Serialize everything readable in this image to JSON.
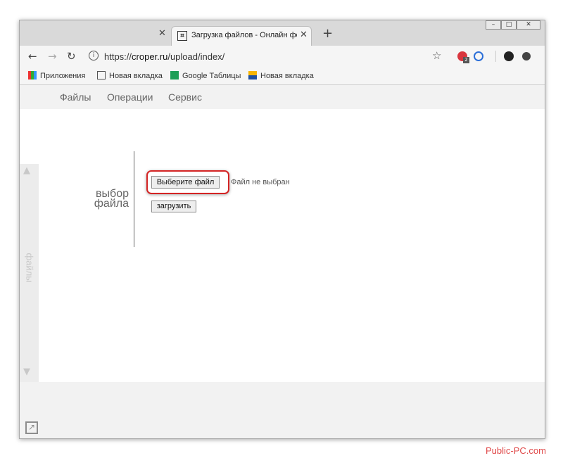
{
  "browser": {
    "tab_title": "Загрузка файлов - Онлайн фото",
    "url_prefix": "https://",
    "url_host": "croper.ru",
    "url_path": "/upload/index/",
    "ext_badge": "2"
  },
  "bookmarks": [
    {
      "label": "Приложения",
      "icon": "apps-grid-icon"
    },
    {
      "label": "Новая вкладка",
      "icon": "page-icon"
    },
    {
      "label": "Google Таблицы",
      "icon": "sheets-icon"
    },
    {
      "label": "Новая вкладка",
      "icon": "image-icon"
    }
  ],
  "site_menu": {
    "files": "Файлы",
    "operations": "Операции",
    "service": "Сервис"
  },
  "side_panel": {
    "label": "файлы"
  },
  "upload_form": {
    "section_label_line1": "выбор",
    "section_label_line2": "файла",
    "choose_file_button": "Выберите файл",
    "file_status": "Файл не выбран",
    "upload_button": "загрузить"
  },
  "colors": {
    "highlight": "#d42424",
    "watermark": "#e04848"
  },
  "watermark": "Public-PC.com"
}
